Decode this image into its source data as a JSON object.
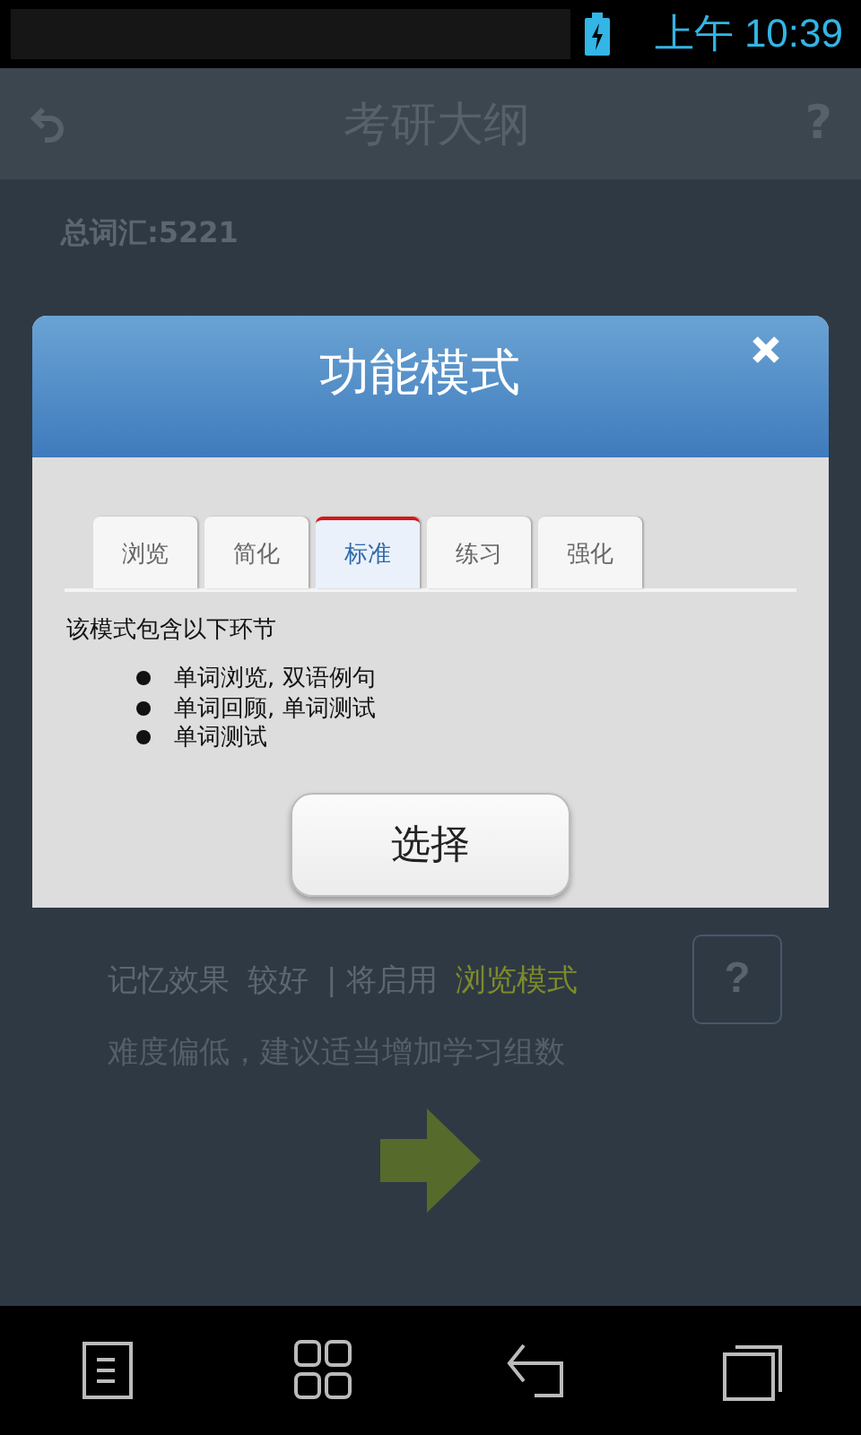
{
  "status_bar": {
    "time": "上午 10:39"
  },
  "app_bar": {
    "title": "考研大纲",
    "help": "?"
  },
  "content": {
    "total": "总词汇:5221",
    "effect_label": "记忆效果",
    "effect_value": "较好",
    "enable_text": "| 将启用",
    "mode_link": "浏览模式",
    "help": "?",
    "hint": "难度偏低，建议适当增加学习组数"
  },
  "dialog": {
    "title": "功能模式",
    "tabs": [
      {
        "label": "浏览",
        "selected": false
      },
      {
        "label": "简化",
        "selected": false
      },
      {
        "label": "标准",
        "selected": true
      },
      {
        "label": "练习",
        "selected": false
      },
      {
        "label": "强化",
        "selected": false
      }
    ],
    "description": "该模式包含以下环节",
    "steps": [
      "单词浏览, 双语例句",
      "单词回顾, 单词测试",
      "单词测试"
    ],
    "select_button": "选择"
  }
}
